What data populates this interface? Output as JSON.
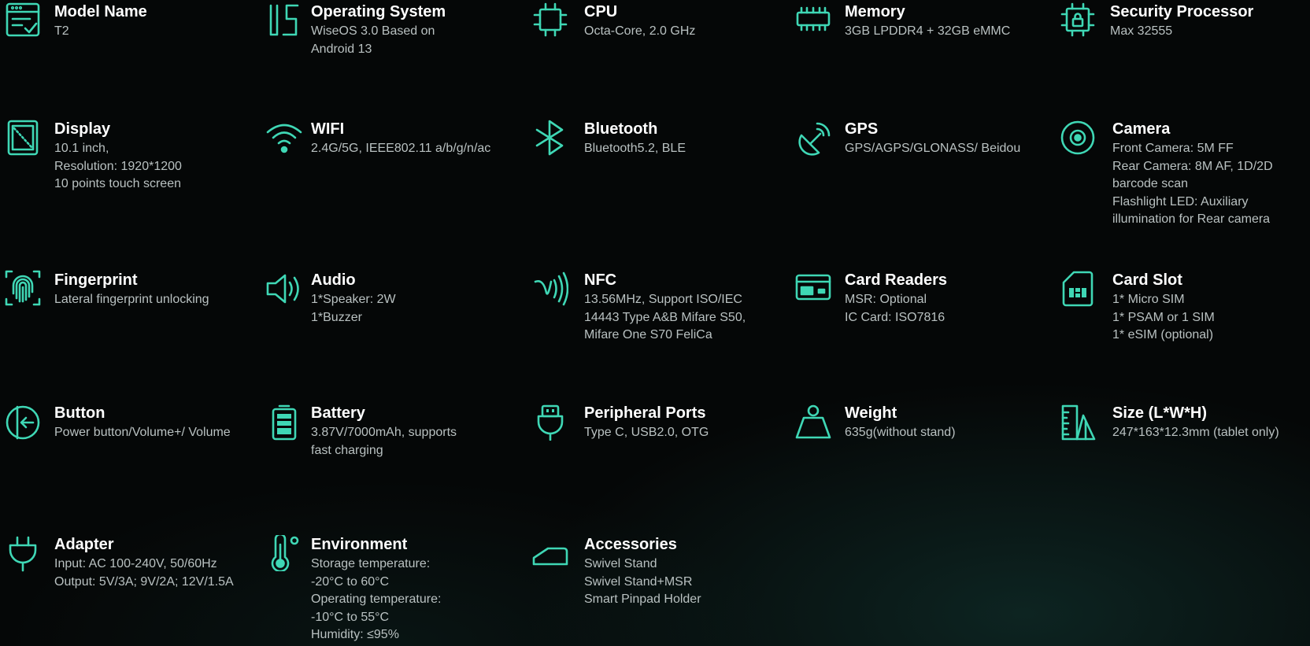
{
  "accent_color": "#3fd7b5",
  "specs": [
    {
      "id": "model-name",
      "icon": "window-check-icon",
      "title": "Model Name",
      "desc": "T2"
    },
    {
      "id": "operating-system",
      "icon": "os-logo-icon",
      "title": "Operating System",
      "desc": "WiseOS 3.0 Based on\nAndroid 13"
    },
    {
      "id": "cpu",
      "icon": "chip-icon",
      "title": "CPU",
      "desc": "Octa-Core, 2.0 GHz"
    },
    {
      "id": "memory",
      "icon": "memory-module-icon",
      "title": "Memory",
      "desc": "3GB LPDDR4 + 32GB eMMC"
    },
    {
      "id": "security-processor",
      "icon": "secure-chip-icon",
      "title": "Security Processor",
      "desc": "Max 32555"
    },
    {
      "id": "display",
      "icon": "tablet-screen-icon",
      "title": "Display",
      "desc": "10.1 inch,\nResolution: 1920*1200\n10 points touch screen"
    },
    {
      "id": "wifi",
      "icon": "wifi-icon",
      "title": "WIFI",
      "desc": "2.4G/5G, IEEE802.11 a/b/g/n/ac"
    },
    {
      "id": "bluetooth",
      "icon": "bluetooth-icon",
      "title": "Bluetooth",
      "desc": "Bluetooth5.2, BLE"
    },
    {
      "id": "gps",
      "icon": "satellite-dish-icon",
      "title": "GPS",
      "desc": "GPS/AGPS/GLONASS/ Beidou"
    },
    {
      "id": "camera",
      "icon": "camera-lens-icon",
      "title": "Camera",
      "desc": "Front Camera: 5M FF\nRear Camera: 8M AF, 1D/2D\nbarcode scan\nFlashlight LED: Auxiliary\nillumination for Rear camera"
    },
    {
      "id": "fingerprint",
      "icon": "fingerprint-icon",
      "title": "Fingerprint",
      "desc": "Lateral fingerprint unlocking"
    },
    {
      "id": "audio",
      "icon": "speaker-icon",
      "title": "Audio",
      "desc": "1*Speaker: 2W\n1*Buzzer"
    },
    {
      "id": "nfc",
      "icon": "nfc-icon",
      "title": "NFC",
      "desc": "13.56MHz, Support ISO/IEC\n14443 Type A&B Mifare S50,\nMifare One S70 FeliCa"
    },
    {
      "id": "card-readers",
      "icon": "credit-card-icon",
      "title": "Card Readers",
      "desc": "MSR: Optional\nIC Card: ISO7816"
    },
    {
      "id": "card-slot",
      "icon": "sim-card-icon",
      "title": "Card Slot",
      "desc": "1* Micro SIM\n1* PSAM or 1 SIM\n1* eSIM (optional)"
    },
    {
      "id": "button",
      "icon": "power-button-icon",
      "title": "Button",
      "desc": "Power button/Volume+/ Volume"
    },
    {
      "id": "battery",
      "icon": "battery-icon",
      "title": "Battery",
      "desc": "3.87V/7000mAh, supports\nfast charging"
    },
    {
      "id": "peripheral-ports",
      "icon": "usb-plug-icon",
      "title": "Peripheral Ports",
      "desc": "Type C, USB2.0, OTG"
    },
    {
      "id": "weight",
      "icon": "weight-icon",
      "title": "Weight",
      "desc": "635g(without stand)"
    },
    {
      "id": "size",
      "icon": "ruler-icon",
      "title": "Size (L*W*H)",
      "desc": "247*163*12.3mm (tablet only)"
    },
    {
      "id": "adapter",
      "icon": "power-plug-icon",
      "title": "Adapter",
      "desc": "Input: AC 100-240V, 50/60Hz\nOutput: 5V/3A; 9V/2A; 12V/1.5A"
    },
    {
      "id": "environment",
      "icon": "thermometer-icon",
      "title": "Environment",
      "desc": "Storage temperature:\n-20°C to 60°C\nOperating temperature:\n-10°C to 55°C\nHumidity: ≤95%"
    },
    {
      "id": "accessories",
      "icon": "stand-icon",
      "title": "Accessories",
      "desc": "Swivel Stand\nSwivel Stand+MSR\nSmart Pinpad Holder"
    }
  ]
}
